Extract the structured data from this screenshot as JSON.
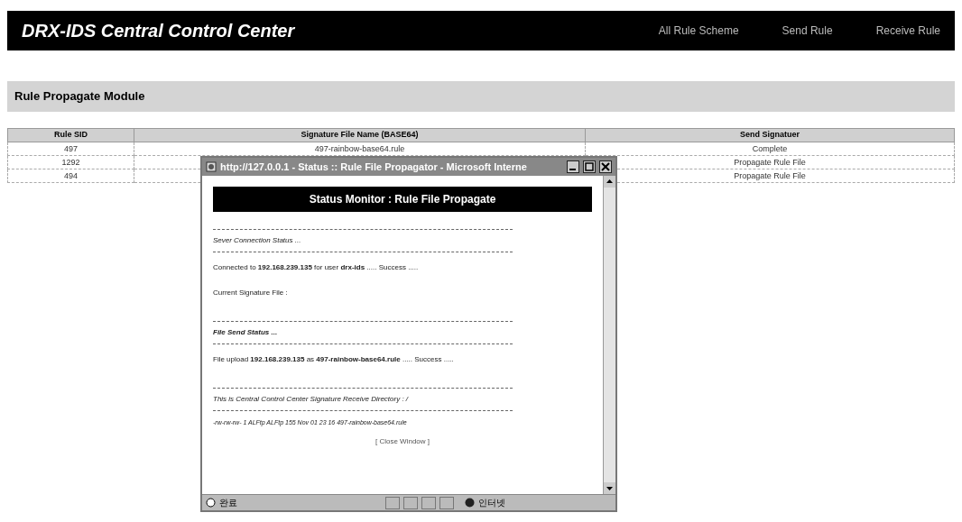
{
  "header": {
    "title": "DRX-IDS Central Control Center",
    "nav": [
      "All Rule Scheme",
      "Send Rule",
      "Receive Rule"
    ]
  },
  "section": {
    "title": "Rule Propagate Module"
  },
  "table": {
    "columns": [
      "Rule SID",
      "Signature File Name (BASE64)",
      "Send Signatuer"
    ],
    "rows": [
      {
        "sid": "497",
        "file": "497-rainbow-base64.rule",
        "status": "Complete"
      },
      {
        "sid": "1292",
        "status": "Propagate Rule File"
      },
      {
        "sid": "494",
        "status": "Propagate Rule File"
      }
    ]
  },
  "popup": {
    "title": "http://127.0.0.1 - Status :: Rule File Propagator - Microsoft Interne",
    "banner": "Status Monitor : Rule File Propagate",
    "lines": [
      {
        "kind": "rule"
      },
      {
        "kind": "heading",
        "bold": false,
        "text": "Sever Connection Status ..."
      },
      {
        "kind": "rule"
      },
      {
        "kind": "text",
        "text": "Connected to **192.168.239.135** for user **drx-ids** ..... Success ....."
      },
      {
        "kind": "text",
        "text": "Current Signature File :"
      },
      {
        "kind": "gap"
      },
      {
        "kind": "rule"
      },
      {
        "kind": "heading",
        "bold": true,
        "text": "File Send Status ..."
      },
      {
        "kind": "rule"
      },
      {
        "kind": "text",
        "text": "File upload **192.168.239.135** as **497-rainbow-base64.rule** ..... Success ....."
      },
      {
        "kind": "gap"
      },
      {
        "kind": "rule"
      },
      {
        "kind": "heading",
        "bold": false,
        "text": "This is Central Control Center Signature Receive Directory : /"
      },
      {
        "kind": "rule"
      },
      {
        "kind": "small",
        "text": "-rw-rw-rw- 1 ALFtp ALFtp 155 Nov 01 23 16 497-rainbow-base64.rule"
      }
    ],
    "close": "[ Close Window ]",
    "status_left": "완료",
    "status_zone": "인터넷"
  }
}
